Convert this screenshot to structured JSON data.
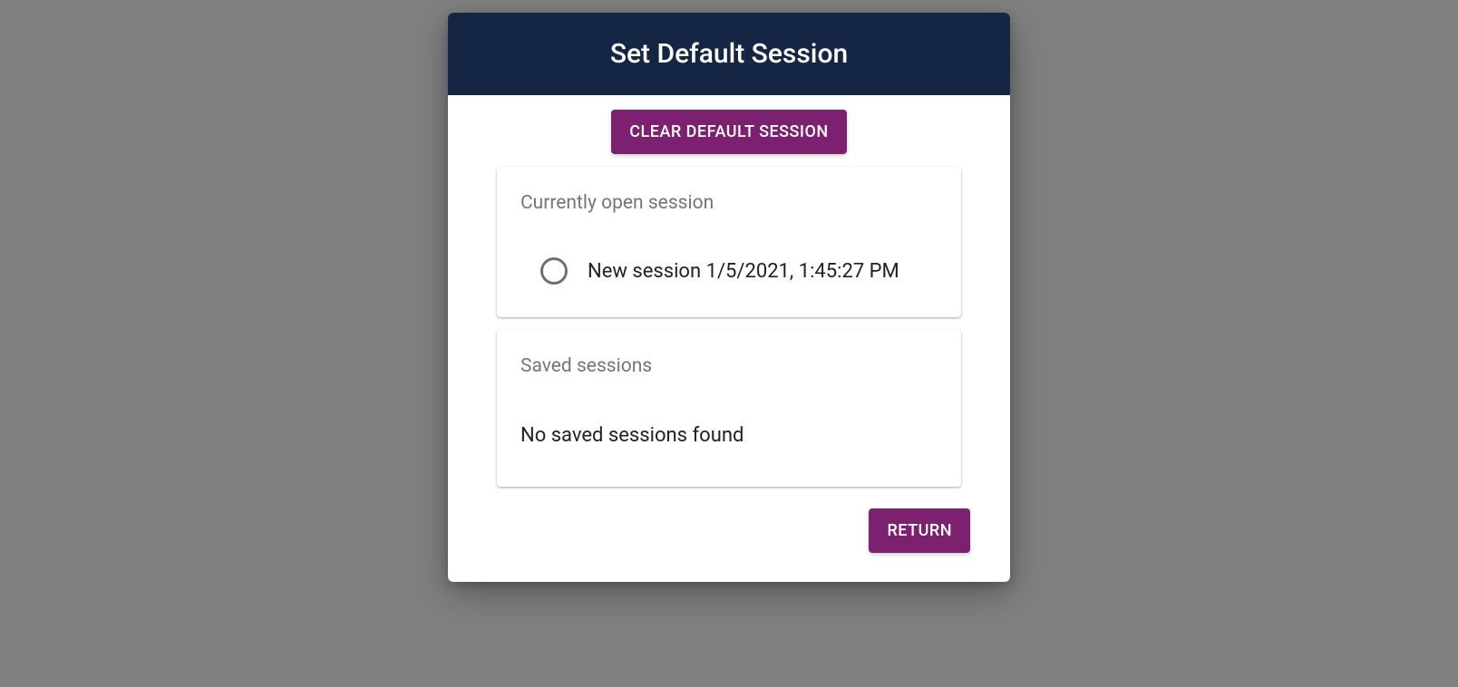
{
  "dialog": {
    "title": "Set Default Session",
    "clear_button_label": "Clear Default Session",
    "return_button_label": "Return"
  },
  "current_session": {
    "heading": "Currently open session",
    "item_label": "New session 1/5/2021, 1:45:27 PM"
  },
  "saved_sessions": {
    "heading": "Saved sessions",
    "empty_message": "No saved sessions found"
  },
  "colors": {
    "header_bg": "#152644",
    "accent": "#7b2170",
    "overlay_bg": "#808080"
  }
}
